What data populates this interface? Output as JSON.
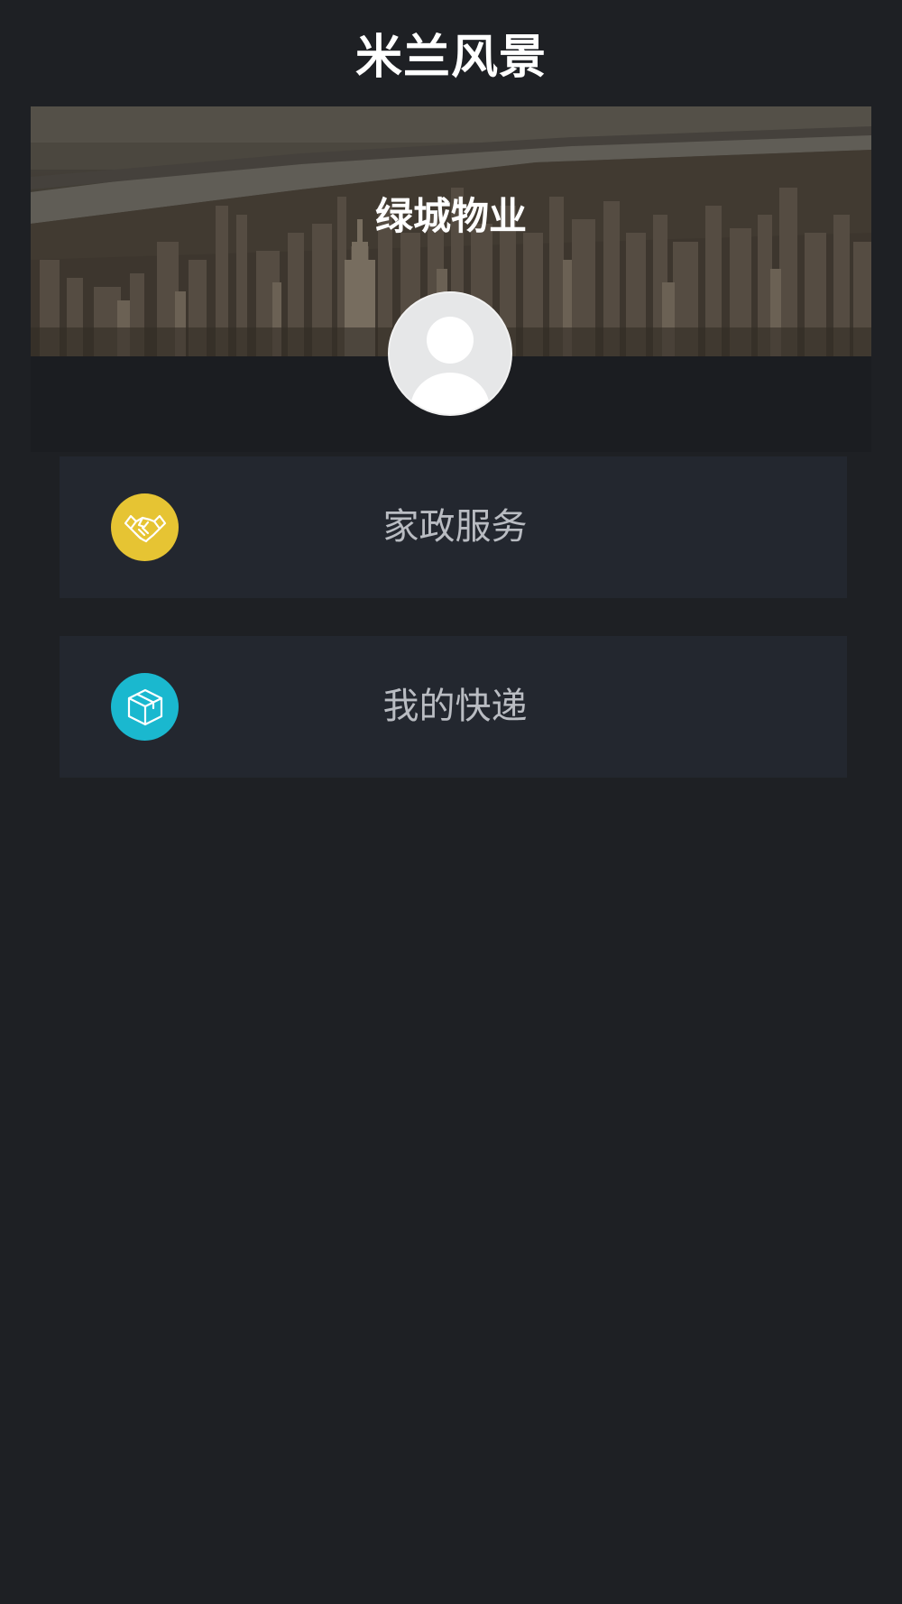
{
  "header": {
    "title": "米兰风景"
  },
  "hero": {
    "subtitle": "绿城物业",
    "image": "city-skyline-photo"
  },
  "profile": {
    "avatar": "default-user-avatar"
  },
  "menu": {
    "items": [
      {
        "label": "家政服务",
        "icon": "handshake-icon",
        "icon_color": "#e6c433"
      },
      {
        "label": "我的快递",
        "icon": "package-box-icon",
        "icon_color": "#1ab8cf"
      }
    ]
  },
  "colors": {
    "background": "#1e2024",
    "card": "#23272f",
    "title_text": "#ffffff",
    "menu_text": "#b9bcc2"
  }
}
